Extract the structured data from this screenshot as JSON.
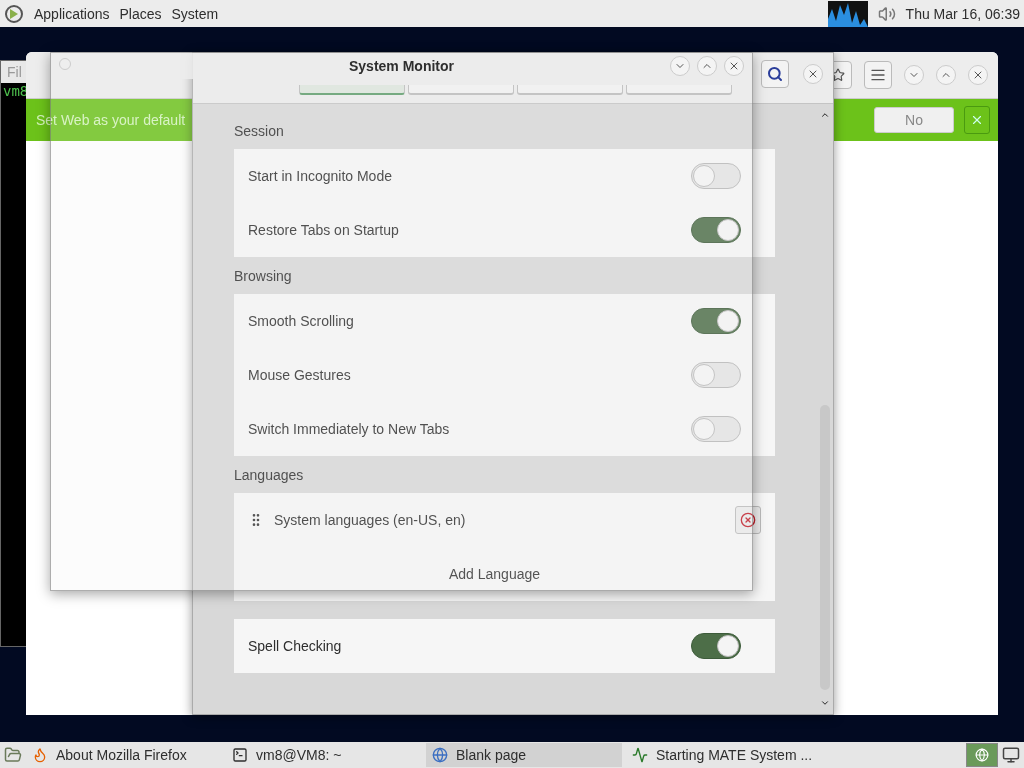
{
  "top_panel": {
    "menus": [
      "Applications",
      "Places",
      "System"
    ],
    "clock": "Thu Mar 16, 06:39"
  },
  "terminal": {
    "menu_text": "Fil",
    "prompt": "vm8"
  },
  "browser": {
    "infobar": {
      "message": "Set Web as your default",
      "button": "No"
    }
  },
  "preferences": {
    "tabs": [
      {
        "selected": true
      },
      {
        "selected": false
      },
      {
        "selected": false
      },
      {
        "selected": false
      }
    ],
    "sections": [
      {
        "title": "Session",
        "rows": [
          {
            "kind": "toggle",
            "label": "Start in Incognito Mode",
            "on": false
          },
          {
            "kind": "toggle",
            "label": "Restore Tabs on Startup",
            "on": true
          }
        ]
      },
      {
        "title": "Browsing",
        "rows": [
          {
            "kind": "toggle",
            "label": "Smooth Scrolling",
            "on": true
          },
          {
            "kind": "toggle",
            "label": "Mouse Gestures",
            "on": false
          },
          {
            "kind": "toggle",
            "label": "Switch Immediately to New Tabs",
            "on": false
          }
        ]
      },
      {
        "title": "Languages",
        "rows": [
          {
            "kind": "language",
            "label": "System languages (en-US, en)"
          },
          {
            "kind": "action",
            "label": "Add Language"
          }
        ]
      },
      {
        "rows": [
          {
            "kind": "toggle",
            "label": "Spell Checking",
            "on": true
          }
        ]
      }
    ]
  },
  "system_monitor": {
    "title": "System Monitor"
  },
  "taskbar": {
    "tasks": [
      {
        "kind": "firefox",
        "label": "About Mozilla Firefox",
        "selected": false
      },
      {
        "kind": "terminal",
        "label": "vm8@VM8: ~",
        "selected": false
      },
      {
        "kind": "web",
        "label": "Blank page",
        "selected": true
      },
      {
        "kind": "monitor",
        "label": "Starting MATE System ...",
        "selected": false
      }
    ]
  }
}
